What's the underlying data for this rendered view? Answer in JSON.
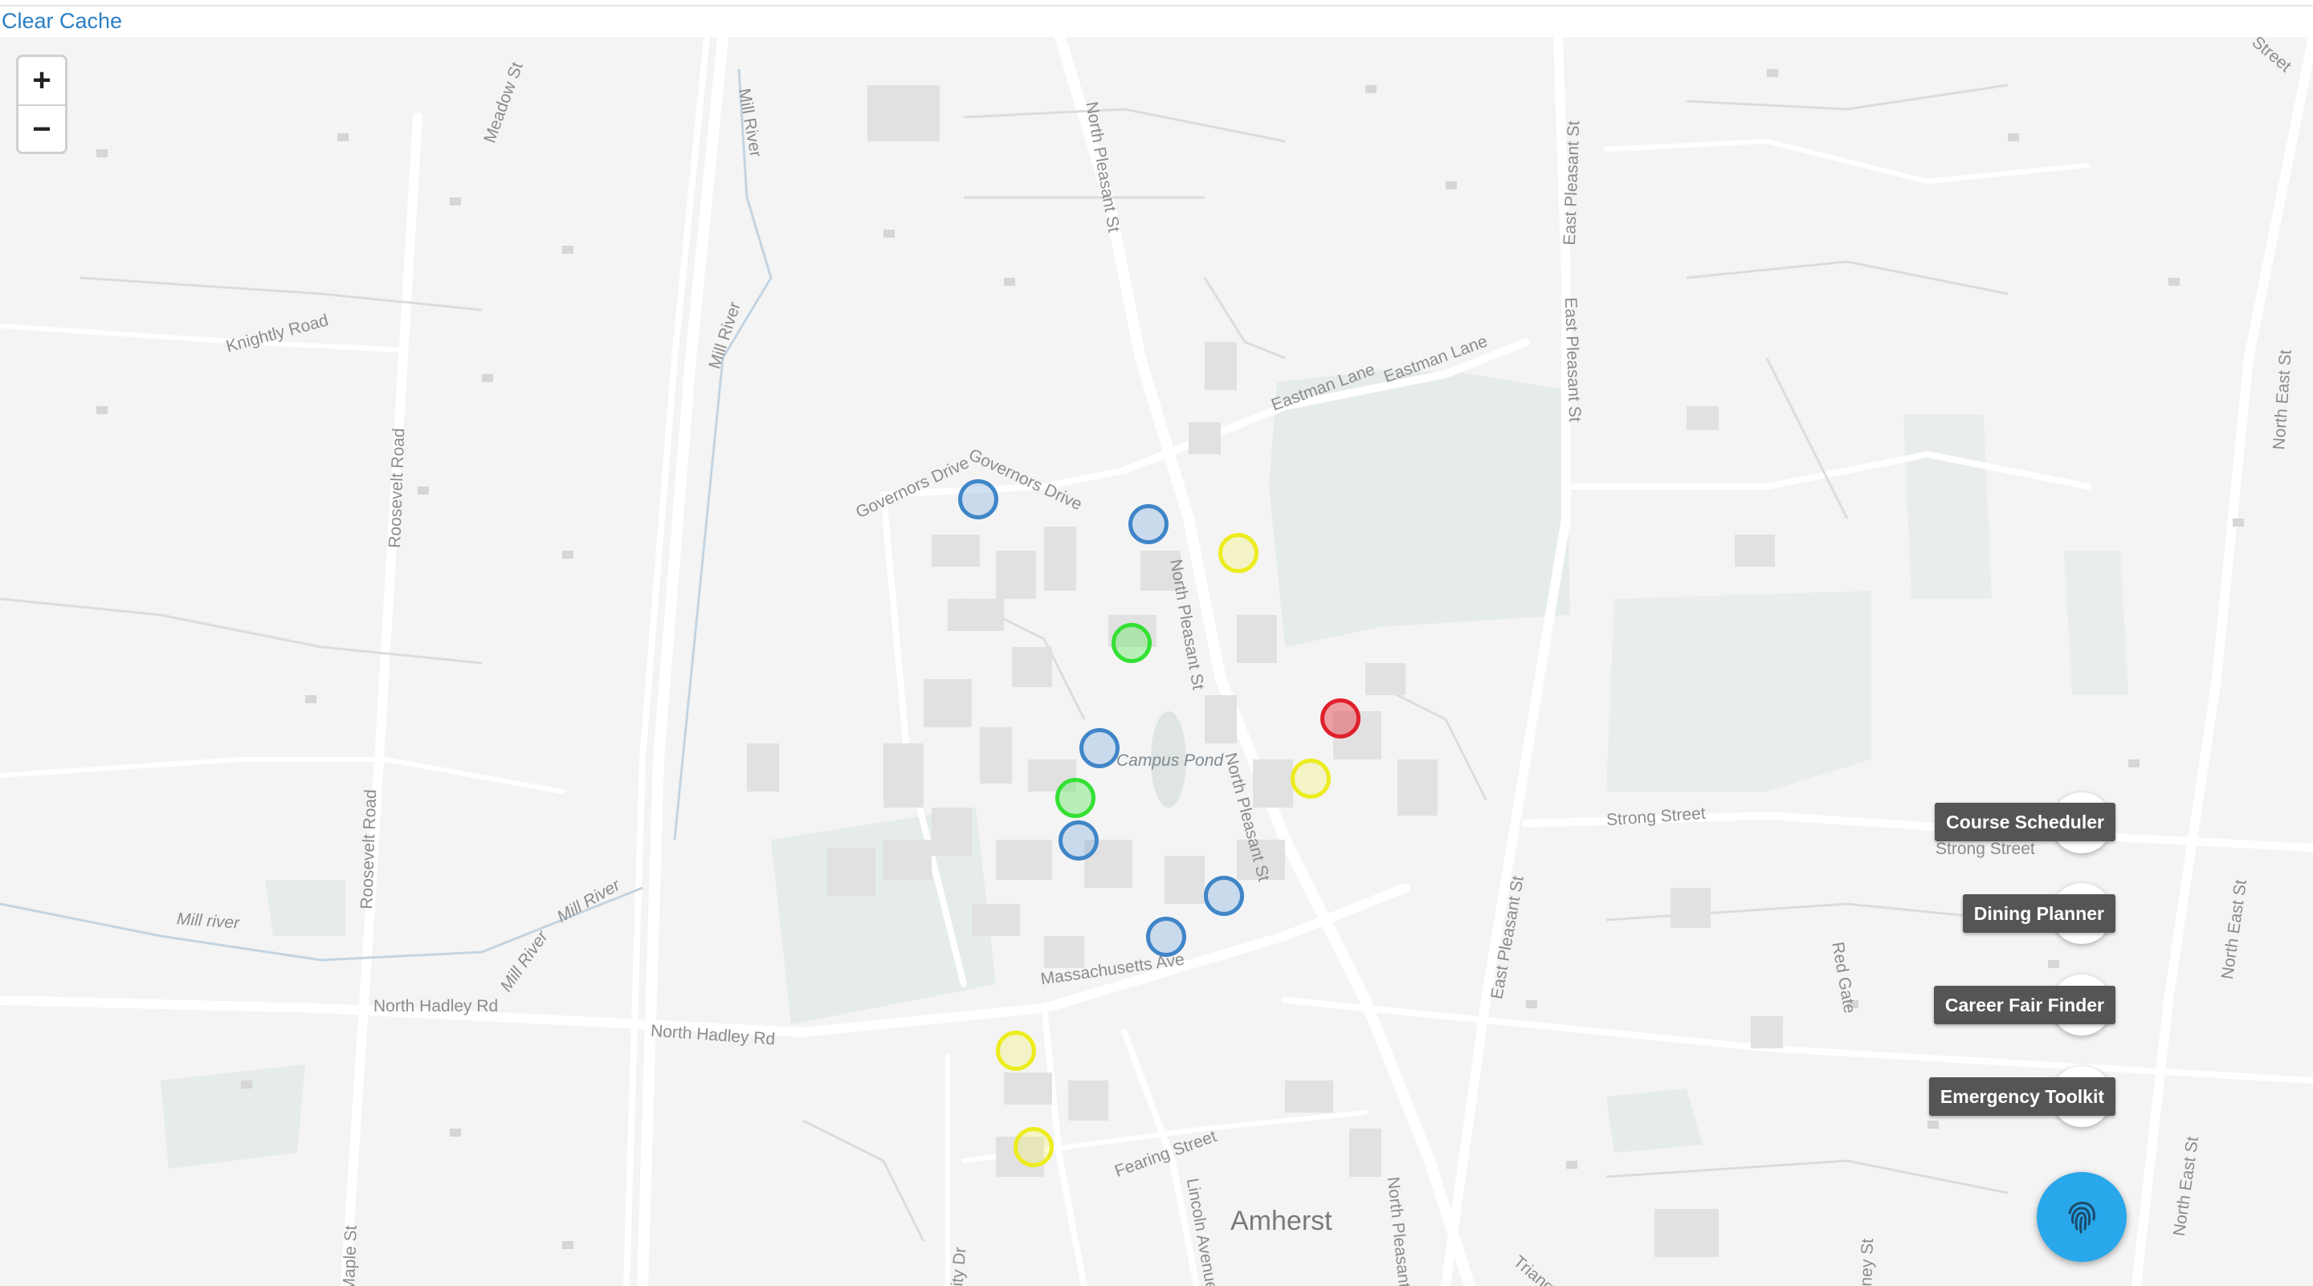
{
  "header": {
    "clear_cache_label": "Clear Cache"
  },
  "zoom": {
    "in_label": "+",
    "out_label": "−"
  },
  "map": {
    "town_label": "Amherst",
    "street_labels": {
      "meadow_st": "Meadow St",
      "mill_river_1": "Mill River",
      "mill_river_2": "Mill River",
      "mill_river_3": "Mill River",
      "mill_river_4": "Mill River",
      "mill_river_lower": "Mill river",
      "knightly_road": "Knightly Road",
      "roosevelt_road_1": "Roosevelt Road",
      "roosevelt_road_2": "Roosevelt Road",
      "north_pleasant_1": "North Pleasant St",
      "north_pleasant_2": "North Pleasant St",
      "north_pleasant_3": "North Pleasant St",
      "north_pleasant_4": "North Pleasant St",
      "governors_drive": "Governors Drive",
      "governors_drive_2": "Governors Drive",
      "eastman_lane_1": "Eastman Lane",
      "eastman_lane_2": "Eastman Lane",
      "east_pleasant_1": "East Pleasant St",
      "east_pleasant_2": "East Pleasant St",
      "east_pleasant_3": "East Pleasant St",
      "campus_pond": "Campus Pond",
      "strong_street_1": "Strong Street",
      "strong_street_2": "Strong Street",
      "massachusetts_ave": "Massachusetts Ave",
      "north_hadley_1": "North Hadley Rd",
      "north_hadley_2": "North Hadley Rd",
      "fearing_street": "Fearing Street",
      "lincoln_avenue": "Lincoln Avenue",
      "north_east_st_1": "North East St",
      "north_east_st_2": "North East St",
      "north_east_st_3": "North East St",
      "red_gate": "Red Gate",
      "maple_st": "Maple St",
      "city_dr": "ity Dr",
      "triangle": "Triang",
      "whitney_st": "itney St",
      "east_street": "Street"
    }
  },
  "markers": [
    {
      "color": "blue"
    },
    {
      "color": "blue"
    },
    {
      "color": "yellow"
    },
    {
      "color": "green"
    },
    {
      "color": "red"
    },
    {
      "color": "blue"
    },
    {
      "color": "yellow"
    },
    {
      "color": "green"
    },
    {
      "color": "blue"
    },
    {
      "color": "blue"
    },
    {
      "color": "blue"
    },
    {
      "color": "yellow"
    },
    {
      "color": "yellow"
    }
  ],
  "fab_menu": {
    "items": [
      {
        "label": "Course Scheduler",
        "icon": "book-map-icon"
      },
      {
        "label": "Dining Planner",
        "icon": "food-truck-icon"
      },
      {
        "label": "Career Fair Finder",
        "icon": "bow-tie-icon"
      },
      {
        "label": "Emergency Toolkit",
        "icon": "ambulance-icon"
      }
    ],
    "main_icon": "fingerprint-icon",
    "main_color": "#29a7eb"
  },
  "colors": {
    "link": "#2a7fc4",
    "marker_blue": "#3f85c8",
    "marker_yellow": "#ecec1e",
    "marker_green": "#34e034",
    "marker_red": "#e0202c",
    "label_bg": "#555555"
  }
}
